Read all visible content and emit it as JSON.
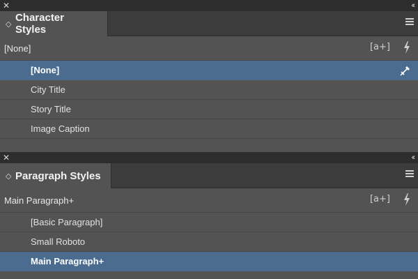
{
  "character_panel": {
    "close_glyph": "✕",
    "collapse_glyph": "‹‹",
    "tab_chevron": "◇",
    "title": "Character Styles",
    "menu_icon": "hamburger-menu-icon",
    "current_style": "[None]",
    "new_style_glyph": "[a+]",
    "items": [
      {
        "label": "[None]",
        "selected": true
      },
      {
        "label": "City Title",
        "selected": false
      },
      {
        "label": "Story Title",
        "selected": false
      },
      {
        "label": "Image Caption",
        "selected": false
      }
    ]
  },
  "paragraph_panel": {
    "close_glyph": "✕",
    "collapse_glyph": "‹‹",
    "tab_chevron": "◇",
    "title": "Paragraph Styles",
    "menu_icon": "hamburger-menu-icon",
    "current_style": "Main Paragraph+",
    "new_style_glyph": "[a+]",
    "items": [
      {
        "label": "[Basic Paragraph]",
        "selected": false
      },
      {
        "label": "Small Roboto",
        "selected": false
      },
      {
        "label": "Main Paragraph+",
        "selected": true
      }
    ]
  },
  "colors": {
    "panel_bg": "#535353",
    "selection": "#4b6c8f",
    "tab_bar": "#3c3c3c",
    "top_strip": "#2d2d2d"
  }
}
